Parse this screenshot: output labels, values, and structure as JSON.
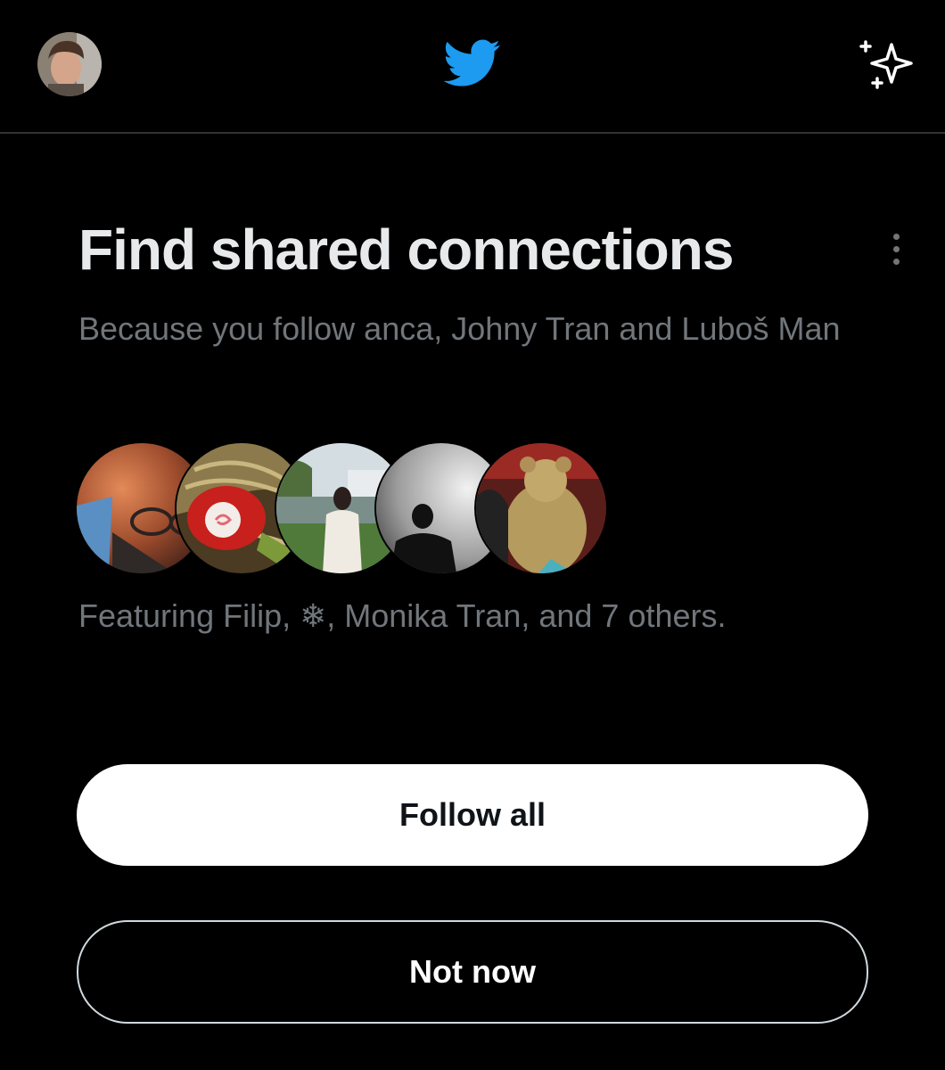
{
  "header": {
    "avatar_icon": "user-avatar",
    "logo_icon": "twitter-bird-icon",
    "sparkle_icon": "sparkle-icon",
    "brand_color": "#1d9bf0"
  },
  "card": {
    "title": "Find shared connections",
    "subtitle": "Because you follow anca, Johny Tran and Luboš Man",
    "featuring": "Featuring Filip, ❄, Monika Tran, and 7 others.",
    "more_icon": "more-vertical-icon"
  },
  "facepile": {
    "count": 5,
    "icons": [
      "face-icon",
      "face-icon",
      "face-icon",
      "face-icon",
      "face-icon"
    ]
  },
  "buttons": {
    "follow_all": "Follow all",
    "not_now": "Not now"
  }
}
